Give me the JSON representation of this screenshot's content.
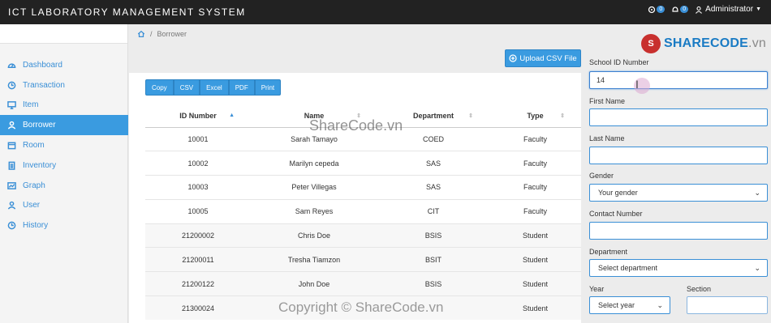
{
  "header": {
    "title": "ICT LABORATORY MANAGEMENT SYSTEM",
    "badge1": "0",
    "badge2": "0",
    "user": "Administrator"
  },
  "sidebar": {
    "items": [
      {
        "label": "Dashboard",
        "icon": "gauge-icon"
      },
      {
        "label": "Transaction",
        "icon": "clock-icon"
      },
      {
        "label": "Item",
        "icon": "monitor-icon"
      },
      {
        "label": "Borrower",
        "icon": "user-icon"
      },
      {
        "label": "Room",
        "icon": "calendar-icon"
      },
      {
        "label": "Inventory",
        "icon": "clipboard-icon"
      },
      {
        "label": "Graph",
        "icon": "chart-icon"
      },
      {
        "label": "User",
        "icon": "user-icon"
      },
      {
        "label": "History",
        "icon": "clock-icon"
      }
    ]
  },
  "breadcrumb": {
    "current": "Borrower"
  },
  "upload_label": "Upload CSV File",
  "export_buttons": [
    "Copy",
    "CSV",
    "Excel",
    "PDF",
    "Print"
  ],
  "table": {
    "columns": [
      "ID Number",
      "Name",
      "Department",
      "Type"
    ],
    "rows": [
      [
        "10001",
        "Sarah Tamayo",
        "COED",
        "Faculty"
      ],
      [
        "10002",
        "Marilyn cepeda",
        "SAS",
        "Faculty"
      ],
      [
        "10003",
        "Peter Villegas",
        "SAS",
        "Faculty"
      ],
      [
        "10005",
        "Sam Reyes",
        "CIT",
        "Faculty"
      ],
      [
        "21200002",
        "Chris Doe",
        "BSIS",
        "Student"
      ],
      [
        "21200011",
        "Tresha Tiamzon",
        "BSIT",
        "Student"
      ],
      [
        "21200122",
        "John Doe",
        "BSIS",
        "Student"
      ],
      [
        "21300024",
        "",
        "",
        "Student"
      ]
    ]
  },
  "form": {
    "school_id_label": "School ID Number",
    "school_id_value": "14",
    "first_name_label": "First Name",
    "last_name_label": "Last Name",
    "gender_label": "Gender",
    "gender_value": "Your gender",
    "contact_label": "Contact Number",
    "department_label": "Department",
    "department_value": "Select department",
    "year_label": "Year",
    "year_value": "Select year",
    "section_label": "Section"
  },
  "logo": {
    "mark": "S",
    "brand": "SHARECODE",
    "suffix": ".vn"
  },
  "watermarks": {
    "center": "ShareCode.vn",
    "bottom": "Copyright © ShareCode.vn"
  },
  "colors": {
    "accent": "#3a9be0",
    "topbar": "#222222"
  }
}
